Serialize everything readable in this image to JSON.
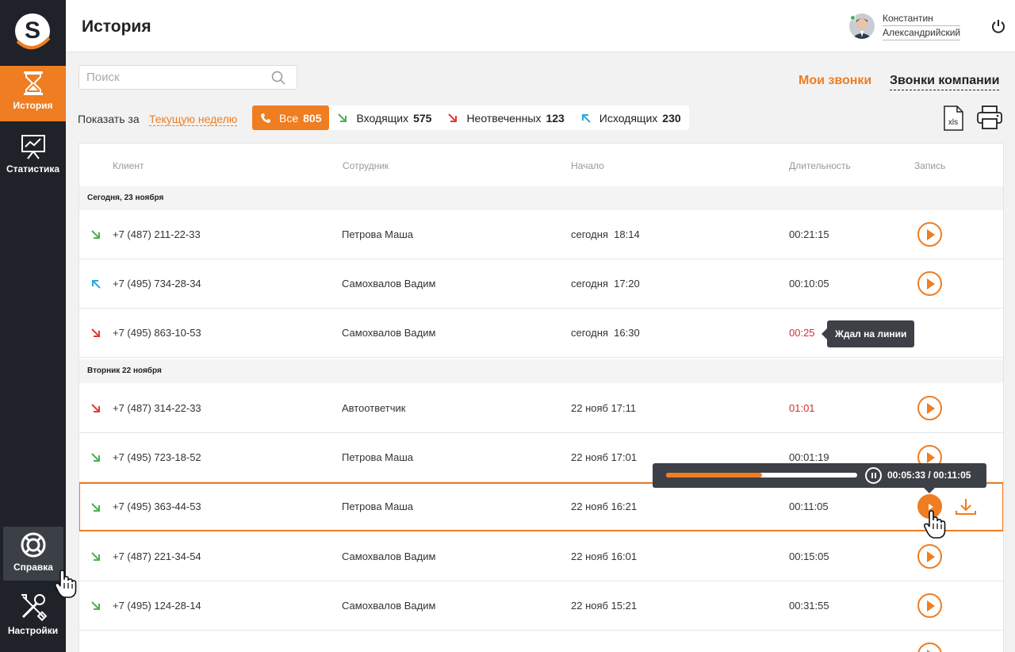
{
  "sidebar": {
    "logo_letter": "S",
    "items": [
      {
        "label": "История"
      },
      {
        "label": "Статистика"
      },
      {
        "label": "Справка"
      },
      {
        "label": "Настройки"
      }
    ]
  },
  "header": {
    "title": "История",
    "user_first": "Константин",
    "user_last": "Александрийский"
  },
  "search": {
    "placeholder": "Поиск"
  },
  "tabs": {
    "my_calls": "Мои звонки",
    "company_calls": "Звонки компании"
  },
  "period": {
    "label": "Показать за",
    "value": "Текущую неделю"
  },
  "filters": [
    {
      "label": "Все",
      "count": "805"
    },
    {
      "label": "Входящих",
      "count": "575"
    },
    {
      "label": "Неотвеченных",
      "count": "123"
    },
    {
      "label": "Исходящих",
      "count": "230"
    }
  ],
  "export": {
    "xls_label": "xls"
  },
  "table": {
    "columns": [
      "Клиент",
      "Сотрудник",
      "Начало",
      "Длительность",
      "Запись"
    ],
    "groups": [
      "Сегодня, 23 ноября",
      "Вторник 22 ноября"
    ],
    "rows": [
      {
        "dir": "incoming",
        "client": "+7 (487) 211-22-33",
        "employee": "Петрова Маша",
        "start": "сегодня  18:14",
        "duration": "00:21:15"
      },
      {
        "dir": "outgoing",
        "client": "+7 (495) 734-28-34",
        "employee": "Самохвалов Вадим",
        "start": "сегодня  17:20",
        "duration": "00:10:05"
      },
      {
        "dir": "missed",
        "client": "+7 (495) 863-10-53",
        "employee": "Самохвалов Вадим",
        "start": "сегодня  16:30",
        "duration": "00:25"
      },
      {
        "dir": "missed",
        "client": "+7 (487) 314-22-33",
        "employee": "Автоответчик",
        "start": "22 нояб 17:11",
        "duration": "01:01"
      },
      {
        "dir": "incoming",
        "client": "+7 (495) 723-18-52",
        "employee": "Петрова Маша",
        "start": "22 нояб 17:01",
        "duration": "00:01:19"
      },
      {
        "dir": "incoming",
        "client": "+7 (495) 363-44-53",
        "employee": "Петрова Маша",
        "start": "22 нояб 16:21",
        "duration": "00:11:05"
      },
      {
        "dir": "incoming",
        "client": "+7 (487) 221-34-54",
        "employee": "Самохвалов Вадим",
        "start": "22 нояб 16:01",
        "duration": "00:15:05"
      },
      {
        "dir": "incoming",
        "client": "+7 (495) 124-28-14",
        "employee": "Самохвалов Вадим",
        "start": "22 нояб 15:21",
        "duration": "00:31:55"
      }
    ]
  },
  "tooltip": {
    "text": "Ждал на линии"
  },
  "player": {
    "time": "00:05:33 / 00:11:05",
    "progress": 0.5
  },
  "colors": {
    "accent": "#ef7d22",
    "sidebar": "#1f2228",
    "incoming": "#4caf50",
    "outgoing": "#29a8e0",
    "missed": "#e53935"
  }
}
